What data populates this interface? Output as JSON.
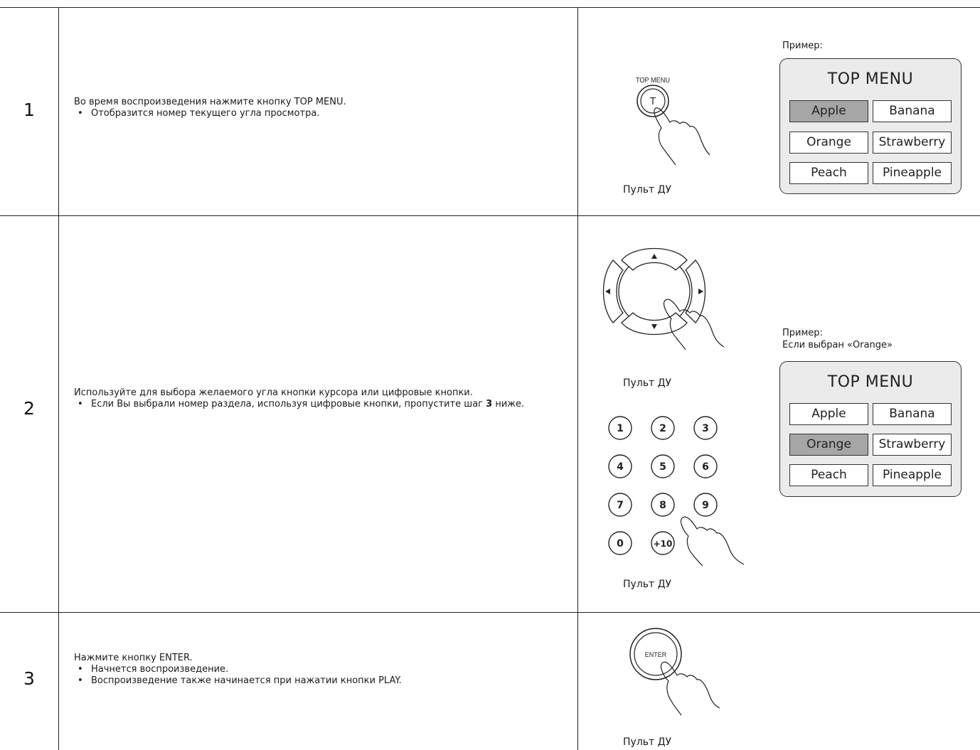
{
  "steps": [
    {
      "number": "1",
      "text": "Во время воспроизведения нажмите кнопку TOP MENU.",
      "bullets": [
        "Отобразится номер текущего угла просмотра."
      ]
    },
    {
      "number": "2",
      "text": "Используйте для выбора желаемого угла кнопки курсора или цифровые кнопки.",
      "bullet_before_bold": "Если Вы выбрали номер раздела, используя цифровые кнопки, пропустите шаг",
      "bullet_bold": "3",
      "bullet_after_bold": "ниже."
    },
    {
      "number": "3",
      "text": "Нажмите кнопку ENTER.",
      "bullets": [
        "Начнется воспроизведение.",
        "Воспроизведение также начинается при нажатии кнопки PLAY."
      ]
    }
  ],
  "remote_label": "Пульт ДУ",
  "bullet_char": "•",
  "top_menu_button_label": "TOP MENU",
  "top_menu_button_letter": "T",
  "enter_button_label": "ENTER",
  "example1": {
    "caption": "Пример:"
  },
  "example2": {
    "caption_line1": "Пример:",
    "caption_line2": "Если выбран «Orange»"
  },
  "menu": {
    "title": "TOP MENU",
    "items": [
      "Apple",
      "Banana",
      "Orange",
      "Strawberry",
      "Peach",
      "Pineapple"
    ]
  },
  "menu1_selected": "Apple",
  "menu2_selected": "Orange",
  "number_keys": [
    "1",
    "2",
    "3",
    "4",
    "5",
    "6",
    "7",
    "8",
    "9",
    "0",
    "+10"
  ],
  "colors": {
    "selected_fill": "#a6a6a6",
    "menu_bg": "#ebebeb",
    "border": "#222222"
  }
}
